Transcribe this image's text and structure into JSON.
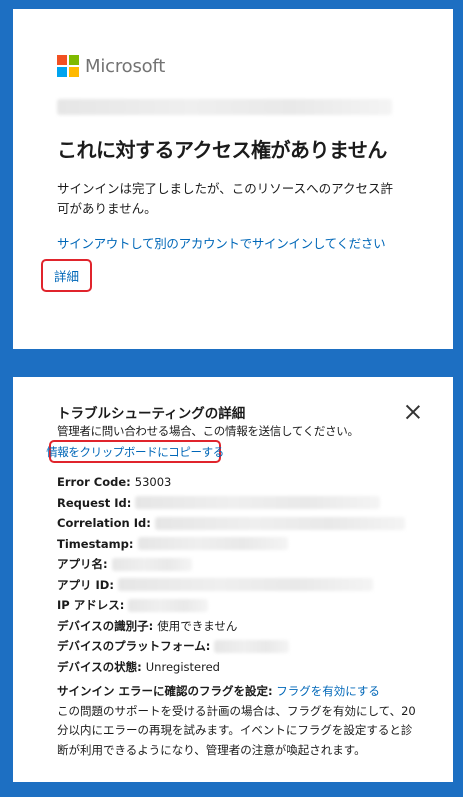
{
  "brand": {
    "name": "Microsoft",
    "colors": [
      "#f25022",
      "#7fba00",
      "#00a4ef",
      "#ffb900"
    ]
  },
  "signin_card": {
    "heading": "これに対するアクセス権がありません",
    "description": "サインインは完了しましたが、このリソースへのアクセス許可がありません。",
    "signout_link": "サインアウトして別のアカウントでサインインしてください",
    "details_link": "詳細"
  },
  "troubleshooting": {
    "heading": "トラブルシューティングの詳細",
    "subtitle": "管理者に問い合わせる場合、この情報を送信してください。",
    "copy_link": "情報をクリップボードにコピーする",
    "fields": [
      {
        "label": "Error Code:",
        "value": "53003"
      },
      {
        "label": "Request Id:",
        "value": ""
      },
      {
        "label": "Correlation Id:",
        "value": ""
      },
      {
        "label": "Timestamp:",
        "value": ""
      },
      {
        "label": "アプリ名:",
        "value": ""
      },
      {
        "label": "アプリ ID:",
        "value": ""
      },
      {
        "label": "IP アドレス:",
        "value": ""
      },
      {
        "label": "デバイスの識別子:",
        "value": "使用できません"
      },
      {
        "label": "デバイスのプラットフォーム:",
        "value": ""
      },
      {
        "label": "デバイスの状態:",
        "value": "Unregistered"
      }
    ],
    "flag_label": "サインイン エラーに確認のフラグを設定:",
    "flag_link": "フラグを有効にする",
    "flag_description": "この問題のサポートを受ける計画の場合は、フラグを有効にして、20 分以内にエラーの再現を試みます。イベントにフラグを設定すると診断が利用できるようになり、管理者の注意が喚起されます。"
  },
  "highlight_color": "#e0242c",
  "link_color": "#0067b8"
}
